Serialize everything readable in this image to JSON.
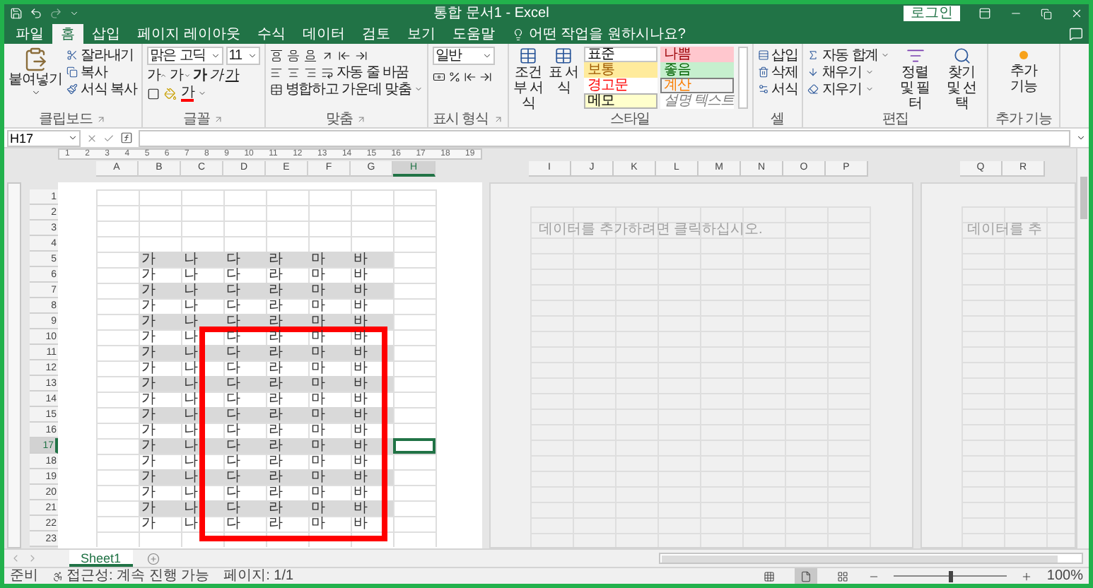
{
  "title_bar": {
    "title": "통합 문서1 - Excel",
    "sign_in": "로그인"
  },
  "ribbon_tabs": [
    {
      "label": "파일",
      "selected": false
    },
    {
      "label": "홈",
      "selected": true
    },
    {
      "label": "삽입",
      "selected": false
    },
    {
      "label": "페이지 레이아웃",
      "selected": false
    },
    {
      "label": "수식",
      "selected": false
    },
    {
      "label": "데이터",
      "selected": false
    },
    {
      "label": "검토",
      "selected": false
    },
    {
      "label": "보기",
      "selected": false
    },
    {
      "label": "도움말",
      "selected": false
    }
  ],
  "tell_me": {
    "placeholder": "어떤 작업을 원하시나요?"
  },
  "clipboard": {
    "label": "클립보드",
    "paste": "붙여넣기",
    "items": [
      {
        "kind": "cut",
        "label": "잘라내기"
      },
      {
        "kind": "copy",
        "label": "복사"
      },
      {
        "kind": "format_painter",
        "label": "서식 복사"
      }
    ]
  },
  "font": {
    "label": "글꼴",
    "font_name": "맑은 고딕",
    "font_size": "11",
    "buttons": [
      {
        "kind": "grow",
        "text": "가"
      },
      {
        "kind": "shrink",
        "text": "가"
      },
      {
        "kind": "bold",
        "text": "가"
      },
      {
        "kind": "italic",
        "text": "가"
      },
      {
        "kind": "underline",
        "text": "가"
      }
    ],
    "font_color": "가"
  },
  "alignment": {
    "label": "맞춤",
    "wrap_text": "자동 줄 바꿈",
    "merge_center": "병합하고 가운데 맞춤"
  },
  "number": {
    "label": "표시 형식",
    "format": "일반"
  },
  "styles": {
    "label": "스타일",
    "conditional": "조건부 서식",
    "format_as_table": "표 서식",
    "gallery": [
      {
        "kind": "normal",
        "label": "표준"
      },
      {
        "kind": "bad",
        "label": "나쁨"
      },
      {
        "kind": "neutral",
        "label": "보통"
      },
      {
        "kind": "good",
        "label": "좋음"
      },
      {
        "kind": "warning",
        "label": "경고문"
      },
      {
        "kind": "calculation",
        "label": "계산"
      },
      {
        "kind": "note",
        "label": "메모"
      },
      {
        "kind": "explanatory",
        "label": "설명 텍스트"
      }
    ]
  },
  "cells": {
    "label": "셀",
    "buttons": [
      {
        "kind": "insert",
        "label": "삽입"
      },
      {
        "kind": "delete",
        "label": "삭제"
      },
      {
        "kind": "format",
        "label": "서식"
      }
    ]
  },
  "editing": {
    "label": "편집",
    "items": [
      {
        "kind": "autosum",
        "label": "자동 합계"
      },
      {
        "kind": "fill",
        "label": "채우기"
      },
      {
        "kind": "clear",
        "label": "지우기"
      }
    ],
    "sort_filter": "정렬 및 필터",
    "find_select": "찾기 및 선택"
  },
  "add_ins": {
    "label": "추가 기능",
    "button": "추가 기능"
  },
  "formula_bar": {
    "name_box": "H17"
  },
  "ruler": [
    "1",
    "2",
    "3",
    "4",
    "5",
    "6",
    "7",
    "8",
    "9",
    "10",
    "11",
    "12",
    "13",
    "14",
    "15",
    "16",
    "17",
    "18",
    "19"
  ],
  "sheet": {
    "columns": [
      {
        "label": "A",
        "selected": false
      },
      {
        "label": "B",
        "selected": false
      },
      {
        "label": "C",
        "selected": false
      },
      {
        "label": "D",
        "selected": false
      },
      {
        "label": "E",
        "selected": false
      },
      {
        "label": "F",
        "selected": false
      },
      {
        "label": "G",
        "selected": false
      },
      {
        "label": "H",
        "selected": true
      }
    ],
    "rows": [
      {
        "number": "1",
        "shaded": false,
        "selected": false
      },
      {
        "number": "2",
        "shaded": false,
        "selected": false
      },
      {
        "number": "3",
        "shaded": false,
        "selected": false
      },
      {
        "number": "4",
        "shaded": false,
        "selected": false
      },
      {
        "number": "5",
        "shaded": true,
        "selected": false,
        "cells": [
          "가",
          "나",
          "다",
          "라",
          "마",
          "바"
        ]
      },
      {
        "number": "6",
        "shaded": false,
        "selected": false,
        "cells": [
          "가",
          "나",
          "다",
          "라",
          "마",
          "바"
        ]
      },
      {
        "number": "7",
        "shaded": true,
        "selected": false,
        "cells": [
          "가",
          "나",
          "다",
          "라",
          "마",
          "바"
        ]
      },
      {
        "number": "8",
        "shaded": false,
        "selected": false,
        "cells": [
          "가",
          "나",
          "다",
          "라",
          "마",
          "바"
        ]
      },
      {
        "number": "9",
        "shaded": true,
        "selected": false,
        "cells": [
          "가",
          "나",
          "다",
          "라",
          "마",
          "바"
        ]
      },
      {
        "number": "10",
        "shaded": false,
        "selected": false,
        "cells": [
          "가",
          "나",
          "다",
          "라",
          "마",
          "바"
        ]
      },
      {
        "number": "11",
        "shaded": true,
        "selected": false,
        "cells": [
          "가",
          "나",
          "다",
          "라",
          "마",
          "바"
        ]
      },
      {
        "number": "12",
        "shaded": false,
        "selected": false,
        "cells": [
          "가",
          "나",
          "다",
          "라",
          "마",
          "바"
        ]
      },
      {
        "number": "13",
        "shaded": true,
        "selected": false,
        "cells": [
          "가",
          "나",
          "다",
          "라",
          "마",
          "바"
        ]
      },
      {
        "number": "14",
        "shaded": false,
        "selected": false,
        "cells": [
          "가",
          "나",
          "다",
          "라",
          "마",
          "바"
        ]
      },
      {
        "number": "15",
        "shaded": true,
        "selected": false,
        "cells": [
          "가",
          "나",
          "다",
          "라",
          "마",
          "바"
        ]
      },
      {
        "number": "16",
        "shaded": false,
        "selected": false,
        "cells": [
          "가",
          "나",
          "다",
          "라",
          "마",
          "바"
        ]
      },
      {
        "number": "17",
        "shaded": true,
        "selected": true,
        "cells": [
          "가",
          "나",
          "다",
          "라",
          "마",
          "바"
        ]
      },
      {
        "number": "18",
        "shaded": false,
        "selected": false,
        "cells": [
          "가",
          "나",
          "다",
          "라",
          "마",
          "바"
        ]
      },
      {
        "number": "19",
        "shaded": true,
        "selected": false,
        "cells": [
          "가",
          "나",
          "다",
          "라",
          "마",
          "바"
        ]
      },
      {
        "number": "20",
        "shaded": false,
        "selected": false,
        "cells": [
          "가",
          "나",
          "다",
          "라",
          "마",
          "바"
        ]
      },
      {
        "number": "21",
        "shaded": true,
        "selected": false,
        "cells": [
          "가",
          "나",
          "다",
          "라",
          "마",
          "바"
        ]
      },
      {
        "number": "22",
        "shaded": false,
        "selected": false,
        "cells": [
          "가",
          "나",
          "다",
          "라",
          "마",
          "바"
        ]
      },
      {
        "number": "23",
        "shaded": false,
        "selected": false
      }
    ]
  },
  "page2": {
    "columns": [
      "I",
      "J",
      "K",
      "L",
      "M",
      "N",
      "O",
      "P"
    ],
    "prompt": "데이터를 추가하려면 클릭하십시오."
  },
  "page3": {
    "columns": [
      "Q",
      "R"
    ],
    "prompt": "데이터를 추"
  },
  "sheet_tabs": [
    {
      "label": "Sheet1",
      "selected": true
    }
  ],
  "status_bar": {
    "mode": "준비",
    "accessibility": "접근성: 계속 진행 가능",
    "page": "페이지: 1/1",
    "views": [
      {
        "kind": "normal",
        "selected": false
      },
      {
        "kind": "page_layout",
        "selected": true
      },
      {
        "kind": "page_break",
        "selected": false
      }
    ],
    "zoom": {
      "level": 0.5,
      "reading": "100%"
    }
  }
}
